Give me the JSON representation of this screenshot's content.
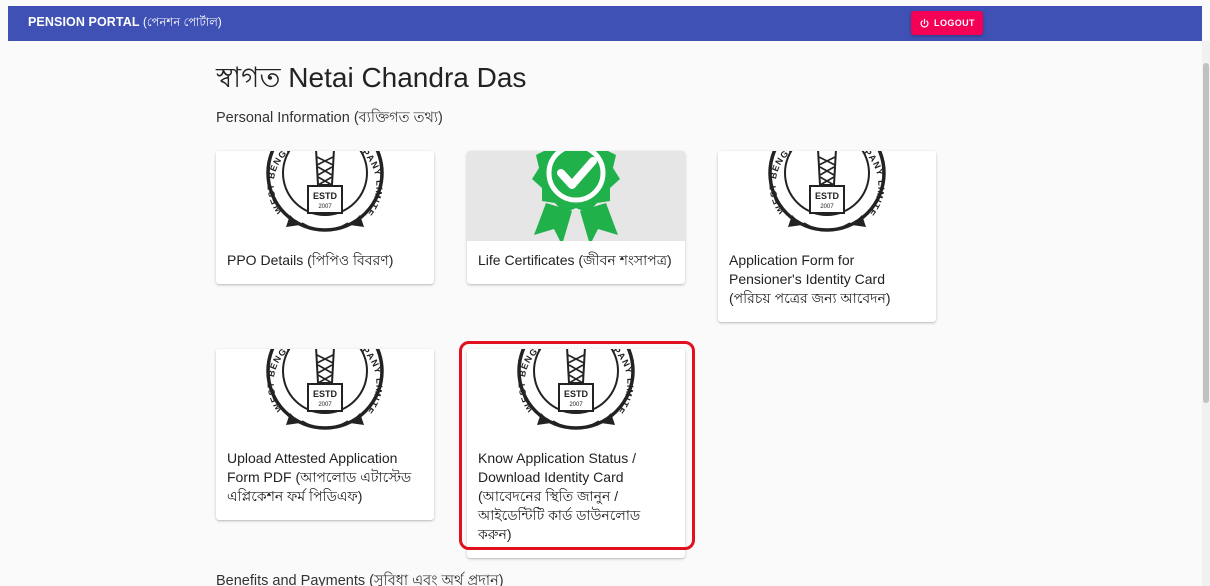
{
  "header": {
    "brand": "PENSION PORTAL",
    "brand_sub": "(পেনশন পোর্টাল)",
    "logout_label": "LOGOUT",
    "bar_color": "#3f51b5",
    "logout_color": "#f50057"
  },
  "welcome": "স্বাগত Netai Chandra Das",
  "sections": {
    "personal": "Personal Information (ব্যক্তিগত তথ্য)",
    "benefits": "Benefits and Payments (সুবিধা এবং অর্থ প্রদান)"
  },
  "cards": [
    {
      "icon": "company-seal-icon",
      "label": "PPO Details (পিপিও বিবরণ)"
    },
    {
      "icon": "verified-badge-icon",
      "label": "Life Certificates (জীবন শংসাপত্র)"
    },
    {
      "icon": "company-seal-icon",
      "label": "Application Form for Pensioner's Identity Card (পরিচয় পত্রের জন্য আবেদন)"
    },
    {
      "icon": "company-seal-icon",
      "label": "Upload Attested Application Form PDF (আপলোড এটাস্টেড এপ্লিকেশন ফর্ম পিডিএফ)"
    },
    {
      "icon": "company-seal-icon",
      "label": "Know Application Status / Download Identity Card (আবেদনের স্থিতি জানুন / আইডেন্টিটি কার্ড ডাউনলোড করুন)"
    }
  ],
  "seal_text": {
    "left_arc": "WEST BENGAL STATE",
    "right_arc": "COMPANY LIMITED",
    "estd": "ESTD",
    "year": "2007"
  },
  "highlight_color": "#e0101f",
  "badge_color": "#21b14b"
}
